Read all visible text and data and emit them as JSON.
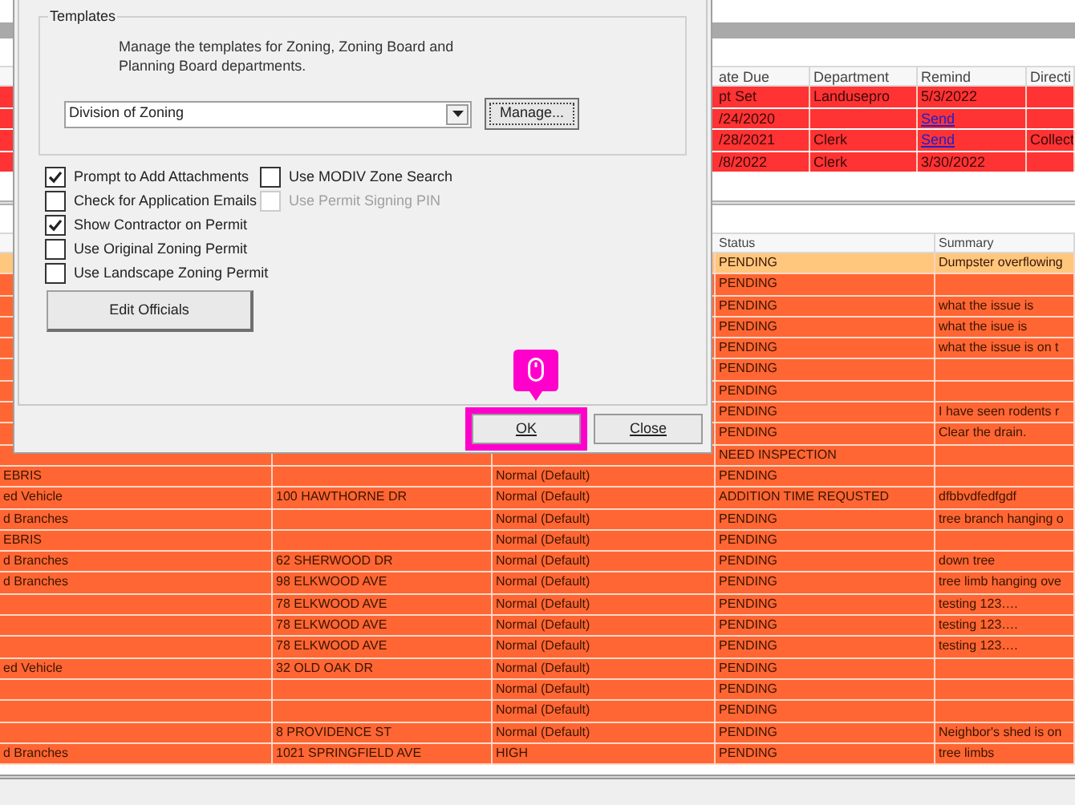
{
  "upper_table": {
    "columns": [
      "ate Due",
      "Department",
      "Remind",
      "Directi"
    ],
    "rows": [
      {
        "date_due": "pt Set",
        "department": "Landusepro",
        "remind": {
          "text": "5/3/2022",
          "kind": "text"
        }
      },
      {
        "date_due": "/24/2020",
        "remind": {
          "text": "Send",
          "kind": "link"
        }
      },
      {
        "date_due": "/28/2021",
        "department": "Clerk",
        "remind": {
          "text": "Send",
          "kind": "link"
        },
        "direction": "Collect"
      },
      {
        "date_due": "/8/2022",
        "department": "Clerk",
        "remind": {
          "text": "3/30/2022",
          "kind": "text"
        }
      }
    ]
  },
  "lower_table": {
    "columns": [
      "Status",
      "Summary"
    ],
    "rows": [
      {
        "selected": true,
        "status": "PENDING",
        "summary": "Dumpster overflowing"
      },
      {
        "selected": false,
        "status": "PENDING"
      },
      {
        "selected": false,
        "status": "PENDING",
        "summary": "what the issue is"
      },
      {
        "selected": false,
        "status": "PENDING",
        "summary": "what the isue is"
      },
      {
        "selected": false,
        "status": "PENDING",
        "summary": "what the issue is on t"
      },
      {
        "selected": false,
        "status": "PENDING"
      },
      {
        "selected": false,
        "status": "PENDING"
      },
      {
        "selected": false,
        "status": "PENDING",
        "summary": "I have seen rodents r"
      },
      {
        "selected": false,
        "status": "PENDING",
        "summary": "Clear the drain."
      },
      {
        "selected": false,
        "status": "NEED INSPECTION"
      },
      {
        "selected": false,
        "column_1": "EBRIS",
        "priority": "Normal (Default)",
        "status": "PENDING"
      },
      {
        "selected": false,
        "column_1": "ed Vehicle",
        "address": "100 HAWTHORNE DR",
        "priority": "Normal (Default)",
        "status": "ADDITION TIME REQUSTED",
        "summary": "dfbbvdfedfgdf"
      },
      {
        "selected": false,
        "column_1": "d Branches",
        "priority": "Normal (Default)",
        "status": "PENDING",
        "summary": "tree branch hanging o"
      },
      {
        "selected": false,
        "column_1": "EBRIS",
        "priority": "Normal (Default)",
        "status": "PENDING"
      },
      {
        "selected": false,
        "column_1": "d Branches",
        "address": "62 SHERWOOD DR",
        "priority": "Normal (Default)",
        "status": "PENDING",
        "summary": "down tree"
      },
      {
        "selected": false,
        "column_1": "d Branches",
        "address": "98 ELKWOOD AVE",
        "priority": "Normal (Default)",
        "status": "PENDING",
        "summary": "tree limb hanging ove"
      },
      {
        "selected": false,
        "address": "78 ELKWOOD AVE",
        "priority": "Normal (Default)",
        "status": "PENDING",
        "summary": "testing 123…."
      },
      {
        "selected": false,
        "address": "78 ELKWOOD AVE",
        "priority": "Normal (Default)",
        "status": "PENDING",
        "summary": "testing 123…."
      },
      {
        "selected": false,
        "address": "78 ELKWOOD AVE",
        "priority": "Normal (Default)",
        "status": "PENDING",
        "summary": "testing 123…."
      },
      {
        "selected": false,
        "column_1": "ed Vehicle",
        "address": "32 OLD OAK DR",
        "priority": "Normal (Default)",
        "status": "PENDING"
      },
      {
        "selected": false,
        "priority": "Normal (Default)",
        "status": "PENDING"
      },
      {
        "selected": false,
        "priority": "Normal (Default)",
        "status": "PENDING"
      },
      {
        "selected": false,
        "address": "8 PROVIDENCE ST",
        "priority": "Normal (Default)",
        "status": "PENDING",
        "summary": "Neighbor's shed is on"
      },
      {
        "selected": false,
        "column_1": "d Branches",
        "address": "1021 SPRINGFIELD AVE",
        "priority": "HIGH",
        "status": "PENDING",
        "summary": "tree limbs"
      }
    ]
  },
  "dialog": {
    "templates": {
      "title": "Templates",
      "description": "Manage the templates for Zoning, Zoning Board and Planning Board departments.",
      "dropdown": {
        "value": "Division of Zoning"
      },
      "manage_button": "Manage..."
    },
    "options_left": [
      {
        "label": "Prompt to Add Attachments",
        "checked": true,
        "disabled": false
      },
      {
        "label": "Check for Application Emails",
        "checked": false,
        "disabled": false
      },
      {
        "label": "Show Contractor on Permit",
        "checked": true,
        "disabled": false
      },
      {
        "label": "Use Original Zoning Permit",
        "checked": false,
        "disabled": false
      },
      {
        "label": "Use Landscape Zoning Permit",
        "checked": false,
        "disabled": false
      }
    ],
    "options_right": [
      {
        "label": "Use MODIV Zone Search",
        "checked": false,
        "disabled": false
      },
      {
        "label": "Use Permit Signing PIN",
        "checked": false,
        "disabled": true
      }
    ],
    "edit_button": "Edit Officials",
    "buttons": [
      {
        "label": "OK",
        "highlighted": true
      },
      {
        "label": "Close",
        "highlighted": false
      }
    ]
  }
}
